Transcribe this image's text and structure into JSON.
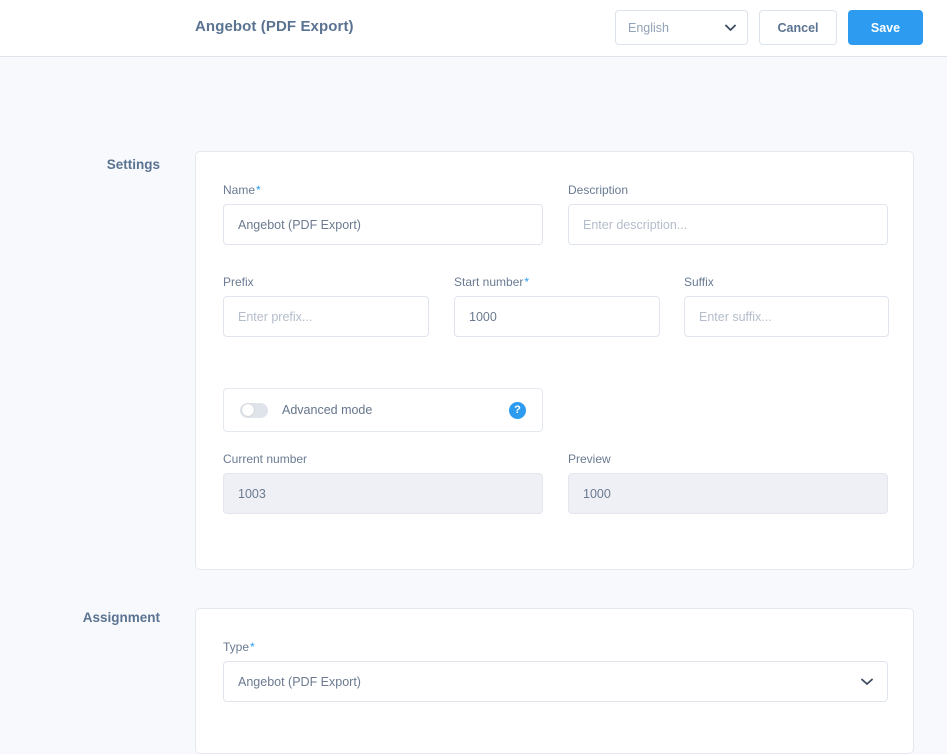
{
  "header": {
    "title": "Angebot (PDF Export)",
    "language_value": "English",
    "language_chevron_icon": "chevron-down-icon",
    "cancel_label": "Cancel",
    "save_label": "Save",
    "accent_color": "#2d9cf0"
  },
  "sections": {
    "settings_label": "Settings",
    "assignment_label": "Assignment"
  },
  "settings": {
    "name": {
      "label": "Name",
      "required_marker": "*",
      "value": "Angebot (PDF Export)"
    },
    "description": {
      "label": "Description",
      "value": "",
      "placeholder": "Enter description..."
    },
    "prefix": {
      "label": "Prefix",
      "value": "",
      "placeholder": "Enter prefix..."
    },
    "start_number": {
      "label": "Start number",
      "required_marker": "*",
      "value": "1000"
    },
    "suffix": {
      "label": "Suffix",
      "value": "",
      "placeholder": "Enter suffix..."
    },
    "advanced_mode": {
      "label": "Advanced mode",
      "state": "off",
      "help_icon": "question-mark-icon",
      "help_glyph": "?"
    },
    "current_number": {
      "label": "Current number",
      "value": "1003",
      "readonly": true
    },
    "preview": {
      "label": "Preview",
      "value": "1000",
      "readonly": true
    }
  },
  "assignment": {
    "type": {
      "label": "Type",
      "required_marker": "*",
      "value": "Angebot (PDF Export)",
      "chevron_icon": "chevron-down-icon"
    }
  }
}
